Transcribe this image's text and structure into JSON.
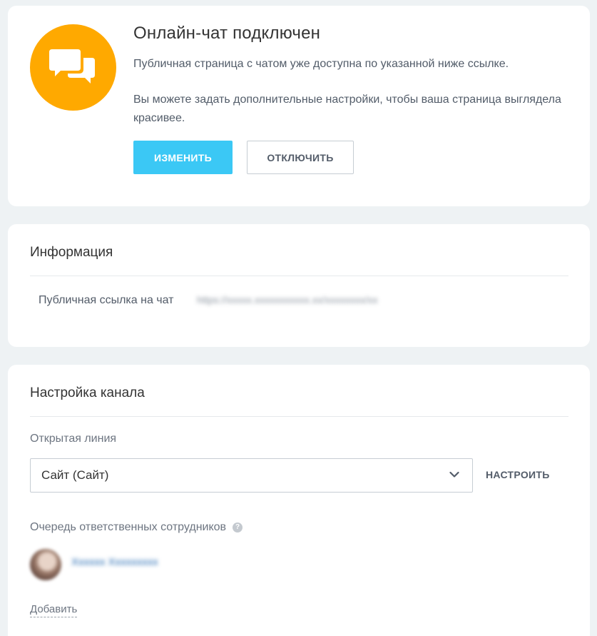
{
  "status": {
    "title": "Онлайн-чат подключен",
    "text_1": "Публичная страница с чатом уже доступна по указанной ниже ссылке.",
    "text_2": "Вы можете задать дополнительные настройки, чтобы ваша страница выглядела красивее.",
    "edit_button": "ИЗМЕНИТЬ",
    "disable_button": "ОТКЛЮЧИТЬ",
    "icon": "chat-bubbles-icon",
    "icon_color": "#ffa900",
    "accent_color": "#3bc8f5"
  },
  "info": {
    "title": "Информация",
    "link_label": "Публичная ссылка на чат",
    "link_value": "https://xxxxx.xxxxxxxxxxx.xx/xxxxxxxx/xx"
  },
  "settings": {
    "title": "Настройка канала",
    "openline_label": "Открытая линия",
    "openline_value": "Сайт (Сайт)",
    "configure_button": "НАСТРОИТЬ",
    "queue_label": "Очередь ответственных сотрудников",
    "help_icon": "help-icon",
    "user_name": "Xxxxxx Xxxxxxxxx",
    "add_link": "Добавить"
  }
}
